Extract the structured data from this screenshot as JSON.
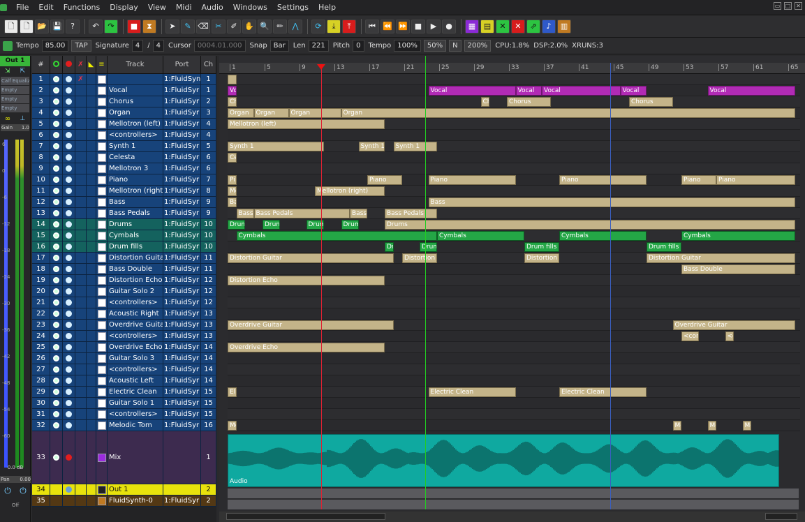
{
  "menubar": {
    "items": [
      "File",
      "Edit",
      "Functions",
      "Display",
      "View",
      "Midi",
      "Audio",
      "Windows",
      "Settings",
      "Help"
    ]
  },
  "toolbar": {
    "buttons": [
      {
        "name": "new-file-button",
        "glyph": "🗋",
        "style": "white"
      },
      {
        "name": "new-template-button",
        "glyph": "🗋",
        "style": "white"
      },
      {
        "name": "open-button",
        "glyph": "📂",
        "style": ""
      },
      {
        "name": "save-button",
        "glyph": "💾",
        "style": ""
      },
      {
        "name": "whats-this-button",
        "glyph": "?",
        "style": ""
      },
      {
        "name": "sep",
        "glyph": "",
        "style": "sep"
      },
      {
        "name": "undo-button",
        "glyph": "↶",
        "style": ""
      },
      {
        "name": "redo-button",
        "glyph": "↷",
        "style": "green"
      },
      {
        "name": "sep",
        "glyph": "",
        "style": "sep"
      },
      {
        "name": "color-button",
        "glyph": "■",
        "style": "red"
      },
      {
        "name": "metronome-button",
        "glyph": "⧗",
        "style": "orange"
      },
      {
        "name": "sep",
        "glyph": "",
        "style": "sep"
      },
      {
        "name": "pointer-tool-button",
        "glyph": "➤",
        "style": ""
      },
      {
        "name": "pencil-tool-button",
        "glyph": "✎",
        "style": "cyan"
      },
      {
        "name": "eraser-tool-button",
        "glyph": "⌫",
        "style": ""
      },
      {
        "name": "cut-tool-button",
        "glyph": "✂",
        "style": "cyan"
      },
      {
        "name": "glue-tool-button",
        "glyph": "✐",
        "style": ""
      },
      {
        "name": "hand-tool-button",
        "glyph": "✋",
        "style": ""
      },
      {
        "name": "zoom-tool-button",
        "glyph": "🔍",
        "style": ""
      },
      {
        "name": "draw-tool-button",
        "glyph": "✏",
        "style": ""
      },
      {
        "name": "automation-tool-button",
        "glyph": "⋀",
        "style": "cyan"
      },
      {
        "name": "sep",
        "glyph": "",
        "style": "sep"
      },
      {
        "name": "loop-button",
        "glyph": "⟳",
        "style": "cyan"
      },
      {
        "name": "punch-in-button",
        "glyph": "⤓",
        "style": "yellow"
      },
      {
        "name": "punch-out-button",
        "glyph": "⤒",
        "style": "red"
      },
      {
        "name": "sep",
        "glyph": "",
        "style": "sep"
      },
      {
        "name": "rewind-start-button",
        "glyph": "⏮",
        "style": ""
      },
      {
        "name": "rewind-button",
        "glyph": "⏪",
        "style": ""
      },
      {
        "name": "forward-button",
        "glyph": "⏩",
        "style": ""
      },
      {
        "name": "stop-button",
        "glyph": "■",
        "style": ""
      },
      {
        "name": "play-button",
        "glyph": "▶",
        "style": ""
      },
      {
        "name": "record-button",
        "glyph": "●",
        "style": ""
      },
      {
        "name": "sep",
        "glyph": "",
        "style": "sep"
      },
      {
        "name": "pianoroll-button",
        "glyph": "▦",
        "style": "violet"
      },
      {
        "name": "list-editor-button",
        "glyph": "▤",
        "style": "yellow"
      },
      {
        "name": "wave-editor-button",
        "glyph": "✕",
        "style": "green"
      },
      {
        "name": "drum-editor-button",
        "glyph": "✕",
        "style": "red"
      },
      {
        "name": "mixer-button",
        "glyph": "⇗",
        "style": "green"
      },
      {
        "name": "score-button",
        "glyph": "♪",
        "style": "blue"
      },
      {
        "name": "synth-button",
        "glyph": "▥",
        "style": "orange"
      }
    ]
  },
  "infobar": {
    "tempo_label": "Tempo",
    "tempo_value": "85.00",
    "tap": "TAP",
    "signature_label": "Signature",
    "sig_num": "4",
    "sig_den": "4",
    "cursor_label": "Cursor",
    "cursor_value": "0004.01.000",
    "snap_label": "Snap",
    "snap_value": "Bar",
    "len_label": "Len",
    "len_value": "221",
    "pitch_label": "Pitch",
    "pitch_value": "0",
    "tempo2_label": "Tempo",
    "tempo2_value": "100%",
    "pct50": "50%",
    "n": "N",
    "pct200": "200%",
    "cpu": "CPU:1.8%",
    "dsp": "DSP:2.0%",
    "xruns": "XRUNS:3"
  },
  "mixer": {
    "strip_name": "Out 1",
    "slots": [
      "Calf Equaliz",
      "Empty",
      "Empty",
      "Empty"
    ],
    "gain_label": "Gain",
    "gain_value": "1.0",
    "db_value": "0.0 dB",
    "pan_label": "Pan",
    "pan_value": "0.00",
    "off": "Off",
    "db_marks": [
      "6",
      "0",
      "-6",
      "-12",
      "-18",
      "-24",
      "-30",
      "-36",
      "-42",
      "-48",
      "-54",
      "-60"
    ]
  },
  "tracklist": {
    "headers": {
      "num": "#",
      "track": "Track",
      "port": "Port",
      "ch": "Ch"
    },
    "rows": [
      {
        "n": "1",
        "name": "",
        "port": "1:FluidSyn",
        "ch": "1",
        "kind": "midi",
        "pin": true
      },
      {
        "n": "2",
        "name": "Vocal",
        "port": "1:FluidSyr",
        "ch": "1",
        "kind": "midi"
      },
      {
        "n": "3",
        "name": "Chorus",
        "port": "1:FluidSyr",
        "ch": "2",
        "kind": "midi"
      },
      {
        "n": "4",
        "name": "Organ",
        "port": "1:FluidSyr",
        "ch": "3",
        "kind": "midi"
      },
      {
        "n": "5",
        "name": "Mellotron (left)",
        "port": "1:FluidSyr",
        "ch": "4",
        "kind": "midi"
      },
      {
        "n": "6",
        "name": "<controllers>",
        "port": "1:FluidSyr",
        "ch": "4",
        "kind": "midi"
      },
      {
        "n": "7",
        "name": "Synth 1",
        "port": "1:FluidSyr",
        "ch": "5",
        "kind": "midi"
      },
      {
        "n": "8",
        "name": "Celesta",
        "port": "1:FluidSyr",
        "ch": "6",
        "kind": "midi"
      },
      {
        "n": "9",
        "name": "Mellotron 3",
        "port": "1:FluidSyr",
        "ch": "6",
        "kind": "midi"
      },
      {
        "n": "10",
        "name": "Piano",
        "port": "1:FluidSyr",
        "ch": "7",
        "kind": "midi"
      },
      {
        "n": "11",
        "name": "Mellotron (right)",
        "port": "1:FluidSyr",
        "ch": "8",
        "kind": "midi"
      },
      {
        "n": "12",
        "name": "Bass",
        "port": "1:FluidSyr",
        "ch": "9",
        "kind": "midi"
      },
      {
        "n": "13",
        "name": "Bass Pedals",
        "port": "1:FluidSyr",
        "ch": "9",
        "kind": "midi"
      },
      {
        "n": "14",
        "name": "Drums",
        "port": "1:FluidSyr",
        "ch": "10",
        "kind": "drum"
      },
      {
        "n": "15",
        "name": "Cymbals",
        "port": "1:FluidSyr",
        "ch": "10",
        "kind": "drum"
      },
      {
        "n": "16",
        "name": "Drum fills",
        "port": "1:FluidSyr",
        "ch": "10",
        "kind": "drum"
      },
      {
        "n": "17",
        "name": "Distortion Guitar",
        "port": "1:FluidSyr",
        "ch": "11",
        "kind": "midi"
      },
      {
        "n": "18",
        "name": "Bass Double",
        "port": "1:FluidSyr",
        "ch": "11",
        "kind": "midi"
      },
      {
        "n": "19",
        "name": "Distortion Echo",
        "port": "1:FluidSyr",
        "ch": "12",
        "kind": "midi"
      },
      {
        "n": "20",
        "name": "Guitar Solo 2",
        "port": "1:FluidSyr",
        "ch": "12",
        "kind": "midi"
      },
      {
        "n": "21",
        "name": "<controllers>",
        "port": "1:FluidSyr",
        "ch": "12",
        "kind": "midi"
      },
      {
        "n": "22",
        "name": "Acoustic Right",
        "port": "1:FluidSyr",
        "ch": "13",
        "kind": "midi"
      },
      {
        "n": "23",
        "name": "Overdrive Guitar",
        "port": "1:FluidSyr",
        "ch": "13",
        "kind": "midi"
      },
      {
        "n": "24",
        "name": "<controllers>",
        "port": "1:FluidSyr",
        "ch": "13",
        "kind": "midi"
      },
      {
        "n": "25",
        "name": "Overdrive Echo",
        "port": "1:FluidSyr",
        "ch": "14",
        "kind": "midi"
      },
      {
        "n": "26",
        "name": "Guitar Solo 3",
        "port": "1:FluidSyr",
        "ch": "14",
        "kind": "midi"
      },
      {
        "n": "27",
        "name": "<controllers>",
        "port": "1:FluidSyr",
        "ch": "14",
        "kind": "midi"
      },
      {
        "n": "28",
        "name": "Acoustic Left",
        "port": "1:FluidSyr",
        "ch": "14",
        "kind": "midi"
      },
      {
        "n": "29",
        "name": "Electric Clean",
        "port": "1:FluidSyr",
        "ch": "15",
        "kind": "midi"
      },
      {
        "n": "30",
        "name": "Guitar Solo 1",
        "port": "1:FluidSyr",
        "ch": "15",
        "kind": "midi"
      },
      {
        "n": "31",
        "name": "<controllers>",
        "port": "1:FluidSyr",
        "ch": "15",
        "kind": "midi"
      },
      {
        "n": "32",
        "name": "Melodic Tom",
        "port": "1:FluidSyr",
        "ch": "16",
        "kind": "midi"
      },
      {
        "n": "33",
        "name": "Mix",
        "port": "",
        "ch": "1",
        "kind": "audio"
      },
      {
        "n": "34",
        "name": "Out 1",
        "port": "",
        "ch": "2",
        "kind": "master"
      },
      {
        "n": "35",
        "name": "FluidSynth-0",
        "port": "1:FluidSyr",
        "ch": "2",
        "kind": "synth"
      }
    ]
  },
  "ruler": {
    "ticks": [
      "1",
      "5",
      "9",
      "13",
      "17",
      "21",
      "25",
      "29",
      "33",
      "37",
      "41",
      "45",
      "49",
      "53",
      "57",
      "61",
      "65"
    ]
  },
  "arranger": {
    "lanes": [
      {
        "row": 0,
        "parts": [
          {
            "bar": 1,
            "len": 1,
            "label": "",
            "c": ""
          }
        ]
      },
      {
        "row": 1,
        "parts": [
          {
            "bar": 1,
            "len": 1,
            "label": "Vo",
            "c": "pink"
          },
          {
            "bar": 24,
            "len": 10,
            "label": "Vocal",
            "c": "pink"
          },
          {
            "bar": 34,
            "len": 3,
            "label": "Vocal",
            "c": "pink"
          },
          {
            "bar": 37,
            "len": 9,
            "label": "Vocal",
            "c": "pink"
          },
          {
            "bar": 46,
            "len": 3,
            "label": "Vocal",
            "c": "pink"
          },
          {
            "bar": 56,
            "len": 10,
            "label": "Vocal",
            "c": "pink"
          }
        ]
      },
      {
        "row": 2,
        "parts": [
          {
            "bar": 1,
            "len": 1,
            "label": "Ch",
            "c": ""
          },
          {
            "bar": 30,
            "len": 1,
            "label": "Ch",
            "c": ""
          },
          {
            "bar": 33,
            "len": 5,
            "label": "Chorus",
            "c": ""
          },
          {
            "bar": 47,
            "len": 5,
            "label": "Chorus",
            "c": ""
          }
        ]
      },
      {
        "row": 3,
        "parts": [
          {
            "bar": 1,
            "len": 3,
            "label": "Organ",
            "c": ""
          },
          {
            "bar": 4,
            "len": 4,
            "label": "Organ",
            "c": ""
          },
          {
            "bar": 8,
            "len": 6,
            "label": "Organ",
            "c": ""
          },
          {
            "bar": 14,
            "len": 52,
            "label": "Organ",
            "c": ""
          }
        ]
      },
      {
        "row": 4,
        "parts": [
          {
            "bar": 1,
            "len": 18,
            "label": "Mellotron (left)",
            "c": ""
          }
        ]
      },
      {
        "row": 6,
        "parts": [
          {
            "bar": 1,
            "len": 11,
            "label": "Synth 1",
            "c": ""
          },
          {
            "bar": 16,
            "len": 3,
            "label": "Synth 1",
            "c": ""
          },
          {
            "bar": 20,
            "len": 5,
            "label": "Synth 1",
            "c": ""
          }
        ]
      },
      {
        "row": 7,
        "parts": [
          {
            "bar": 1,
            "len": 1,
            "label": "Ce",
            "c": ""
          }
        ]
      },
      {
        "row": 9,
        "parts": [
          {
            "bar": 1,
            "len": 1,
            "label": "Pi",
            "c": ""
          },
          {
            "bar": 17,
            "len": 4,
            "label": "Piano",
            "c": ""
          },
          {
            "bar": 24,
            "len": 10,
            "label": "Piano",
            "c": ""
          },
          {
            "bar": 39,
            "len": 10,
            "label": "Piano",
            "c": ""
          },
          {
            "bar": 53,
            "len": 4,
            "label": "Piano",
            "c": ""
          },
          {
            "bar": 57,
            "len": 9,
            "label": "Piano",
            "c": ""
          }
        ]
      },
      {
        "row": 10,
        "parts": [
          {
            "bar": 1,
            "len": 1,
            "label": "Me",
            "c": ""
          },
          {
            "bar": 11,
            "len": 8,
            "label": "Mellotron (right)",
            "c": ""
          }
        ]
      },
      {
        "row": 11,
        "parts": [
          {
            "bar": 1,
            "len": 1,
            "label": "Ba",
            "c": ""
          },
          {
            "bar": 24,
            "len": 42,
            "label": "Bass",
            "c": ""
          }
        ]
      },
      {
        "row": 12,
        "parts": [
          {
            "bar": 2,
            "len": 2,
            "label": "Bass",
            "c": ""
          },
          {
            "bar": 4,
            "len": 11,
            "label": "Bass Pedals",
            "c": ""
          },
          {
            "bar": 15,
            "len": 2,
            "label": "Bass",
            "c": ""
          },
          {
            "bar": 19,
            "len": 6,
            "label": "Bass Pedals",
            "c": ""
          }
        ]
      },
      {
        "row": 13,
        "parts": [
          {
            "bar": 1,
            "len": 2,
            "label": "Drum",
            "c": "green"
          },
          {
            "bar": 5,
            "len": 2,
            "label": "Drum",
            "c": "green"
          },
          {
            "bar": 10,
            "len": 2,
            "label": "Drum",
            "c": "green"
          },
          {
            "bar": 14,
            "len": 2,
            "label": "Drum",
            "c": "green"
          },
          {
            "bar": 19,
            "len": 47,
            "label": "Drums",
            "c": ""
          }
        ]
      },
      {
        "row": 14,
        "parts": [
          {
            "bar": 2,
            "len": 23,
            "label": "Cymbals",
            "c": "green"
          },
          {
            "bar": 25,
            "len": 10,
            "label": "Cymbals",
            "c": "green"
          },
          {
            "bar": 39,
            "len": 10,
            "label": "Cymbals",
            "c": "green"
          },
          {
            "bar": 53,
            "len": 13,
            "label": "Cymbals",
            "c": "green"
          }
        ]
      },
      {
        "row": 15,
        "parts": [
          {
            "bar": 19,
            "len": 1,
            "label": "Dr",
            "c": "green"
          },
          {
            "bar": 23,
            "len": 2,
            "label": "Drum",
            "c": "green"
          },
          {
            "bar": 35,
            "len": 4,
            "label": "Drum fills",
            "c": "green"
          },
          {
            "bar": 49,
            "len": 4,
            "label": "Drum fills",
            "c": "green"
          }
        ]
      },
      {
        "row": 16,
        "parts": [
          {
            "bar": 1,
            "len": 19,
            "label": "Distortion Guitar",
            "c": ""
          },
          {
            "bar": 21,
            "len": 4,
            "label": "Distortion G",
            "c": ""
          },
          {
            "bar": 35,
            "len": 4,
            "label": "Distortion",
            "c": ""
          },
          {
            "bar": 49,
            "len": 17,
            "label": "Distortion Guitar",
            "c": ""
          }
        ]
      },
      {
        "row": 17,
        "parts": [
          {
            "bar": 53,
            "len": 13,
            "label": "Bass Double",
            "c": ""
          }
        ]
      },
      {
        "row": 18,
        "parts": [
          {
            "bar": 1,
            "len": 18,
            "label": "Distortion Echo",
            "c": ""
          }
        ]
      },
      {
        "row": 22,
        "parts": [
          {
            "bar": 1,
            "len": 19,
            "label": "Overdrive Guitar",
            "c": ""
          },
          {
            "bar": 52,
            "len": 14,
            "label": "Overdrive Guitar",
            "c": ""
          }
        ]
      },
      {
        "row": 23,
        "parts": [
          {
            "bar": 53,
            "len": 2,
            "label": "<con",
            "c": ""
          },
          {
            "bar": 58,
            "len": 1,
            "label": "<c",
            "c": ""
          }
        ]
      },
      {
        "row": 24,
        "parts": [
          {
            "bar": 1,
            "len": 18,
            "label": "Overdrive Echo",
            "c": ""
          }
        ]
      },
      {
        "row": 28,
        "parts": [
          {
            "bar": 1,
            "len": 1,
            "label": "El",
            "c": ""
          },
          {
            "bar": 24,
            "len": 10,
            "label": "Electric Clean",
            "c": ""
          },
          {
            "bar": 39,
            "len": 10,
            "label": "Electric Clean",
            "c": ""
          }
        ]
      },
      {
        "row": 31,
        "parts": [
          {
            "bar": 1,
            "len": 1,
            "label": "Me",
            "c": ""
          },
          {
            "bar": 52,
            "len": 1,
            "label": "Me",
            "c": ""
          },
          {
            "bar": 56,
            "len": 1,
            "label": "Me",
            "c": ""
          },
          {
            "bar": 60,
            "len": 1,
            "label": "Me",
            "c": ""
          }
        ]
      }
    ],
    "audio_part_label": "Audio"
  }
}
